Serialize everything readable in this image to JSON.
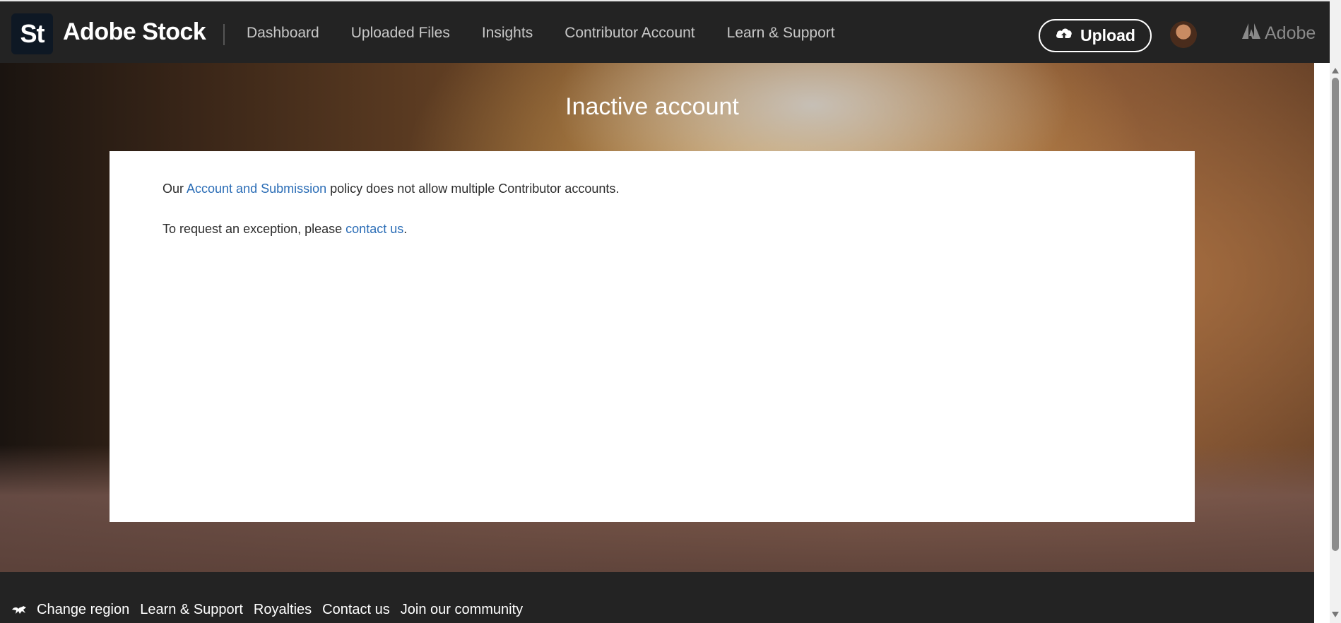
{
  "header": {
    "logo_text": "St",
    "brand": "Adobe Stock",
    "nav": [
      {
        "label": "Dashboard"
      },
      {
        "label": "Uploaded Files"
      },
      {
        "label": "Insights"
      },
      {
        "label": "Contributor Account"
      },
      {
        "label": "Learn & Support"
      }
    ],
    "upload_label": "Upload",
    "adobe_label": "Adobe"
  },
  "hero": {
    "title": "Inactive account"
  },
  "card": {
    "line1_prefix": "Our ",
    "line1_link": "Account and Submission",
    "line1_suffix": " policy does not allow multiple Contributor accounts.",
    "line2_prefix": "To request an exception, please ",
    "line2_link": "contact us",
    "line2_suffix": "."
  },
  "footer": {
    "links": [
      {
        "label": "Change region"
      },
      {
        "label": "Learn & Support"
      },
      {
        "label": "Royalties"
      },
      {
        "label": "Contact us"
      },
      {
        "label": "Join our community"
      }
    ]
  }
}
